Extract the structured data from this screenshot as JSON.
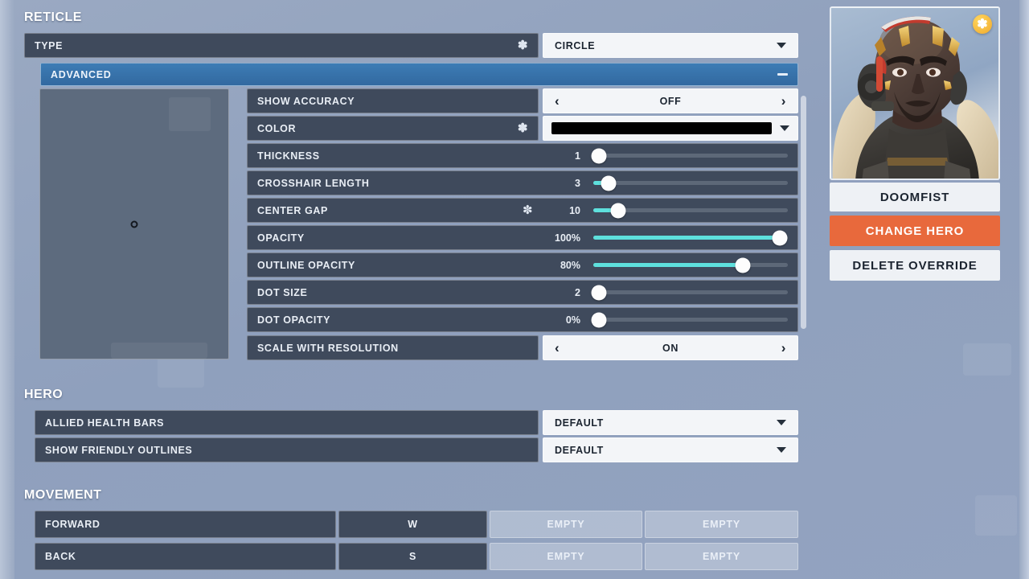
{
  "sections": {
    "reticle": "RETICLE",
    "hero": "HERO",
    "movement": "MOVEMENT"
  },
  "reticle": {
    "type_row": {
      "label": "TYPE",
      "modified": "✽",
      "value": "CIRCLE",
      "chevron": "chevron-down-icon"
    },
    "advanced": {
      "label": "ADVANCED",
      "collapse_icon": "minus-icon",
      "preview": {
        "crosshair": "circle-dot"
      },
      "rows": [
        {
          "label": "SHOW ACCURACY",
          "modified": "",
          "kind": "stepper",
          "value": "OFF",
          "left": "‹",
          "right": "›"
        },
        {
          "label": "COLOR",
          "modified": "✽",
          "kind": "color",
          "value": "#000000"
        },
        {
          "label": "THICKNESS",
          "modified": "",
          "kind": "slider",
          "value": "1",
          "percent": 3
        },
        {
          "label": "CROSSHAIR LENGTH",
          "modified": "",
          "kind": "slider",
          "value": "3",
          "percent": 8
        },
        {
          "label": "CENTER GAP",
          "modified": "✽",
          "kind": "slider",
          "value": "10",
          "percent": 13
        },
        {
          "label": "OPACITY",
          "modified": "",
          "kind": "slider",
          "value": "100%",
          "percent": 96
        },
        {
          "label": "OUTLINE OPACITY",
          "modified": "",
          "kind": "slider",
          "value": "80%",
          "percent": 77
        },
        {
          "label": "DOT SIZE",
          "modified": "",
          "kind": "slider",
          "value": "2",
          "percent": 3
        },
        {
          "label": "DOT OPACITY",
          "modified": "",
          "kind": "slider",
          "value": "0%",
          "percent": 3
        }
      ],
      "footer_row": {
        "label": "SCALE WITH RESOLUTION",
        "kind": "stepper",
        "value": "ON",
        "left": "‹",
        "right": "›"
      }
    }
  },
  "hero_settings": [
    {
      "label": "ALLIED HEALTH BARS",
      "value": "DEFAULT",
      "chevron": "chevron-down-icon"
    },
    {
      "label": "SHOW FRIENDLY OUTLINES",
      "value": "DEFAULT",
      "chevron": "chevron-down-icon"
    }
  ],
  "movement": [
    {
      "label": "FORWARD",
      "primary": "W",
      "secondary": "EMPTY",
      "tertiary": "EMPTY"
    },
    {
      "label": "BACK",
      "primary": "S",
      "secondary": "EMPTY",
      "tertiary": "EMPTY"
    }
  ],
  "hero_panel": {
    "badge": "✽",
    "name": "DOOMFIST",
    "change_hero": "CHANGE HERO",
    "delete_override": "DELETE OVERRIDE"
  },
  "colors": {
    "accent_orange": "#e8693c",
    "accent_blue": "#3269a0",
    "slider_cyan": "#5ee0dd",
    "row_bg": "#3f4a5c"
  }
}
